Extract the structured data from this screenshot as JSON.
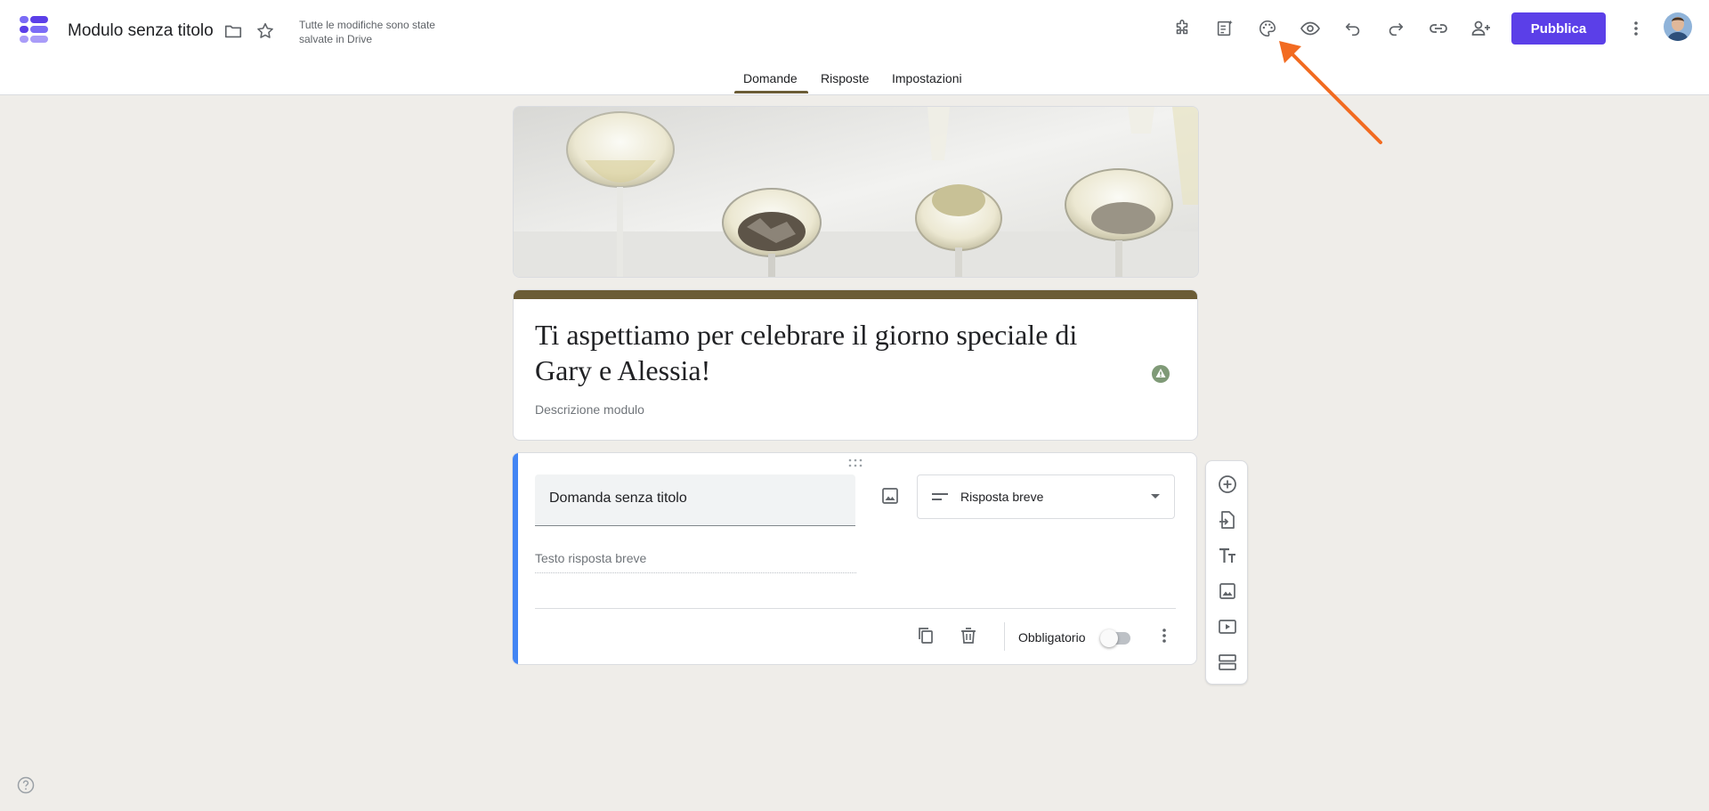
{
  "header": {
    "doc_title": "Modulo senza titolo",
    "save_status": "Tutte le modifiche sono state salvate in Drive",
    "publish_label": "Pubblica",
    "icons": [
      "forms-logo-icon",
      "folder-icon",
      "star-icon",
      "addon-puzzle-icon",
      "customize-theme-icon",
      "palette-icon",
      "eye-preview-icon",
      "undo-icon",
      "redo-icon",
      "link-icon",
      "add-collaborator-icon",
      "more-vert-icon"
    ]
  },
  "tabs": [
    {
      "label": "Domande",
      "active": true
    },
    {
      "label": "Risposte",
      "active": false
    },
    {
      "label": "Impostazioni",
      "active": false
    }
  ],
  "form": {
    "title": "Ti aspettiamo per celebrare il giorno speciale di Gary e Alessia!",
    "description_placeholder": "Descrizione modulo"
  },
  "question": {
    "title": "Domanda senza titolo",
    "type": "Risposta breve",
    "answer_placeholder": "Testo risposta breve",
    "required_label": "Obbligatorio",
    "required": false
  },
  "side_toolbar": [
    "add-question-icon",
    "import-questions-icon",
    "add-title-icon",
    "add-image-icon",
    "add-video-icon",
    "add-section-icon"
  ],
  "colors": {
    "theme_accent": "#6b5c36",
    "publish_button": "#5b3fe8",
    "question_active_bar": "#4285f4",
    "background": "#efede9",
    "annotation_arrow": "#f26b21"
  }
}
